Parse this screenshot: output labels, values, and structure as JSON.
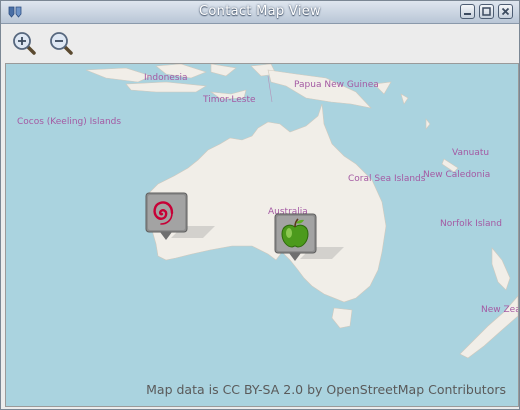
{
  "window": {
    "title": "Contact Map View"
  },
  "toolbar": {
    "zoom_in_icon": "zoom-in-icon",
    "zoom_out_icon": "zoom-out-icon"
  },
  "map": {
    "labels": {
      "indonesia": "Indonesia",
      "papua_new_guinea": "Papua New Guinea",
      "timor_leste": "Timor-Leste",
      "cocos": "Cocos (Keeling) Islands",
      "vanuatu": "Vanuatu",
      "coral_sea": "Coral Sea Islands",
      "new_caledonia": "New Caledonia",
      "australia": "Australia",
      "norfolk": "Norfolk Island",
      "new_zealand": "New Zea"
    },
    "markers": [
      {
        "icon": "debian-swirl-icon"
      },
      {
        "icon": "green-apple-icon"
      }
    ],
    "attribution": "Map data is CC BY-SA 2.0 by OpenStreetMap Contributors",
    "colors": {
      "ocean": "#aad3df",
      "land": "#f1eee8",
      "label": "#a45aa3"
    }
  }
}
